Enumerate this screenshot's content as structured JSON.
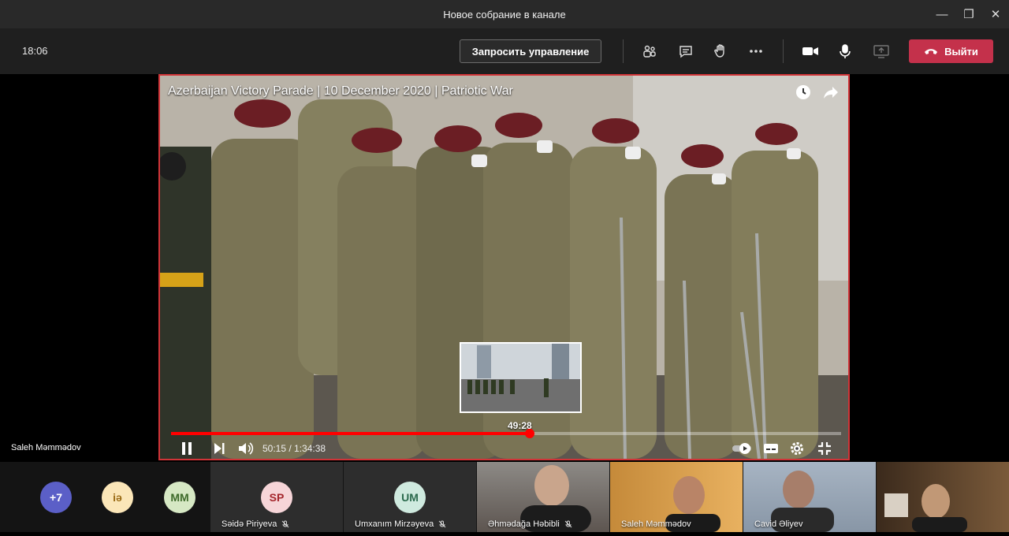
{
  "window": {
    "title": "Новое собрание в канале"
  },
  "toolbar": {
    "time": "18:06",
    "request_control": "Запросить управление",
    "leave": "Выйти",
    "icons": [
      "participants-icon",
      "chat-icon",
      "raise-hand-icon",
      "more-icon",
      "camera-icon",
      "mic-icon",
      "share-icon"
    ]
  },
  "video": {
    "title": "Azerbaijan Victory Parade | 10 December 2020 | Patriotic War",
    "current_time": "50:15",
    "duration": "1:34:38",
    "time_display": "50:15 / 1:34:38",
    "hover_time": "49:28",
    "progress_fraction": 0.535
  },
  "stage": {
    "speaker_name": "Saleh Məmmədov"
  },
  "gallery": {
    "overflow": {
      "label": "+7",
      "color": "#5b5fc7"
    },
    "bubbles": [
      {
        "initials": "iə",
        "bg": "#fbe6b8",
        "fg": "#9a6b14"
      },
      {
        "initials": "MM",
        "bg": "#d6e8c4",
        "fg": "#3d6a2a"
      },
      {
        "initials": "SP",
        "bg": "#f6d5d8",
        "fg": "#a4262c"
      },
      {
        "initials": "UM",
        "bg": "#cfeadf",
        "fg": "#2b6a4d"
      }
    ],
    "tiles": [
      {
        "name": "Səidə Piriyeva"
      },
      {
        "name": "Umxanım Mirzəyeva"
      },
      {
        "name": "Əhmədağa Həbibli"
      },
      {
        "name": "Saleh Məmmədov"
      },
      {
        "name": "Cavid Əliyev"
      }
    ]
  },
  "colors": {
    "accent_red": "#c4314b",
    "progress_red": "#ff0000",
    "border_red": "#d13438"
  }
}
